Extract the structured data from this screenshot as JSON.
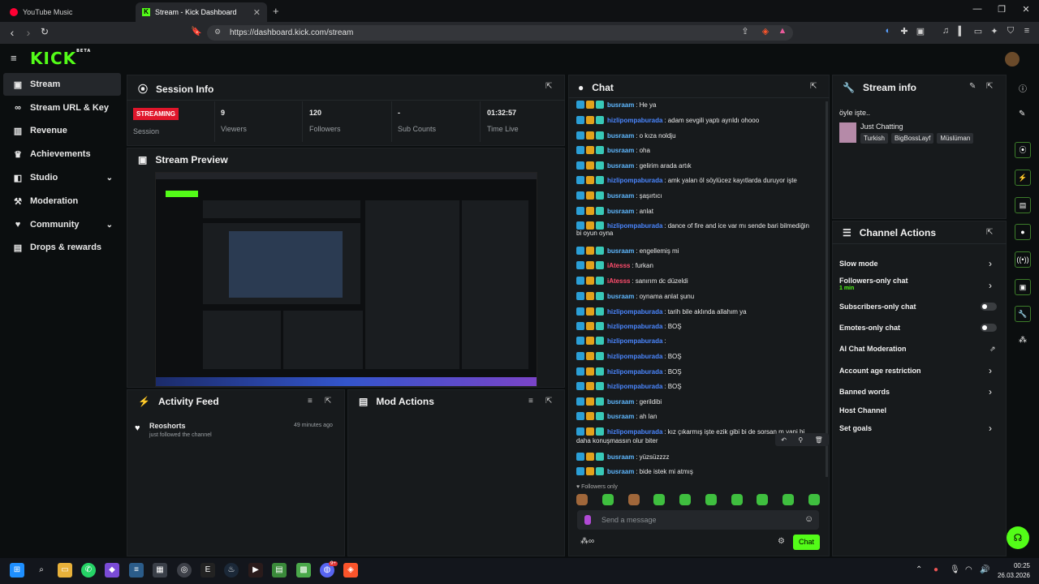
{
  "browser": {
    "tabs": [
      {
        "label": "YouTube Music"
      },
      {
        "label": "Stream - Kick Dashboard"
      }
    ],
    "url": "https://dashboard.kick.com/stream"
  },
  "brand": {
    "logo": "KICK",
    "beta": "BETA",
    "accent": "#53fc18"
  },
  "sidebar": {
    "items": [
      {
        "label": "Stream",
        "icon": "stream-icon"
      },
      {
        "label": "Stream URL & Key",
        "icon": "link-icon"
      },
      {
        "label": "Revenue",
        "icon": "revenue-icon"
      },
      {
        "label": "Achievements",
        "icon": "trophy-icon"
      },
      {
        "label": "Studio",
        "icon": "studio-icon"
      },
      {
        "label": "Moderation",
        "icon": "hammer-icon"
      },
      {
        "label": "Community",
        "icon": "community-icon"
      },
      {
        "label": "Drops & rewards",
        "icon": "drops-icon"
      }
    ]
  },
  "session": {
    "title": "Session Info",
    "status_badge": "STREAMING",
    "status_label": "Session",
    "stats": [
      {
        "value": "9",
        "label": "Viewers"
      },
      {
        "value": "120",
        "label": "Followers"
      },
      {
        "value": "-",
        "label": "Sub Counts"
      },
      {
        "value": "01:32:57",
        "label": "Time Live"
      }
    ]
  },
  "preview": {
    "title": "Stream Preview"
  },
  "activity": {
    "title": "Activity Feed",
    "items": [
      {
        "name": "Reoshorts",
        "text": "just followed the channel",
        "time": "49 minutes ago"
      }
    ]
  },
  "mod": {
    "title": "Mod Actions"
  },
  "chat": {
    "title": "Chat",
    "messages": [
      {
        "user": "busraam",
        "text": "He ya",
        "color": "#5fb8ff"
      },
      {
        "user": "hizlipompaburada",
        "text": "adam sevgili yaptı ayrıldı ohooo",
        "color": "#4a86ff"
      },
      {
        "user": "busraam",
        "text": "o kıza noldju",
        "color": "#5fb8ff"
      },
      {
        "user": "busraam",
        "text": "oha",
        "color": "#5fb8ff"
      },
      {
        "user": "busraam",
        "text": "gelirim arada artık",
        "color": "#5fb8ff"
      },
      {
        "user": "hizlipompaburada",
        "text": "amk yalan öl söylücez kayıtlarda duruyor işte",
        "color": "#4a86ff"
      },
      {
        "user": "busraam",
        "text": "şaşırtıcı",
        "color": "#5fb8ff"
      },
      {
        "user": "busraam",
        "text": "anlat",
        "color": "#5fb8ff"
      },
      {
        "user": "hizlipompaburada",
        "text": "dance of fire and ice var mı sende bari bilmediğin",
        "color": "#4a86ff"
      },
      {
        "user": "busraam",
        "text": "engellemiş mi",
        "color": "#5fb8ff"
      },
      {
        "user": "iAtesss",
        "text": "furkan",
        "color": "#ff4d6d"
      },
      {
        "user": "iAtesss",
        "text": "sanırım dc düzeldi",
        "color": "#ff4d6d"
      },
      {
        "user": "busraam",
        "text": "oynama anlat şunu",
        "color": "#5fb8ff"
      },
      {
        "user": "hizlipompaburada",
        "text": "tarih bile aklında allahım ya",
        "color": "#4a86ff"
      },
      {
        "user": "hizlipompaburada",
        "text": "BOŞ",
        "color": "#4a86ff"
      },
      {
        "user": "hizlipompaburada",
        "text": "",
        "color": "#4a86ff"
      },
      {
        "user": "hizlipompaburada",
        "text": "BOŞ",
        "color": "#4a86ff"
      },
      {
        "user": "hizlipompaburada",
        "text": "BOŞ",
        "color": "#4a86ff"
      },
      {
        "user": "hizlipompaburada",
        "text": "BOŞ",
        "color": "#4a86ff"
      },
      {
        "user": "busraam",
        "text": "gerildibi",
        "color": "#5fb8ff"
      },
      {
        "user": "busraam",
        "text": "ah lan",
        "color": "#5fb8ff"
      },
      {
        "user": "hizlipompaburada",
        "text": "kız çıkarmış işte ezik gibi bi de sorsan m yani bi",
        "color": "#4a86ff"
      },
      {
        "user": "busraam",
        "text": "yüzsüzzzz",
        "color": "#5fb8ff"
      },
      {
        "user": "busraam",
        "text": "bide istek mi atmış",
        "color": "#5fb8ff"
      }
    ],
    "wrap_lines": {
      "m8": "bi oyun oyna",
      "m21": "daha konuşmassın olur biter"
    },
    "followers_only": "Followers only",
    "placeholder": "Send a message",
    "send": "Chat"
  },
  "stream_info": {
    "title": "Stream info",
    "stream_title": "öyle işte..",
    "category": "Just Chatting",
    "tags": [
      "Turkish",
      "BigBossLayf",
      "Müslüman"
    ]
  },
  "channel_actions": {
    "title": "Channel Actions",
    "slow": "Slow mode",
    "followers": "Followers-only chat",
    "followers_sub": "1 min",
    "subs": "Subscribers-only chat",
    "emotes": "Emotes-only chat",
    "ai": "AI Chat Moderation",
    "age": "Account age restriction",
    "banned": "Banned words",
    "host": "Host Channel",
    "goals": "Set goals"
  },
  "system": {
    "time": "00:25",
    "date": "26.03.2026",
    "badge": "9+"
  }
}
